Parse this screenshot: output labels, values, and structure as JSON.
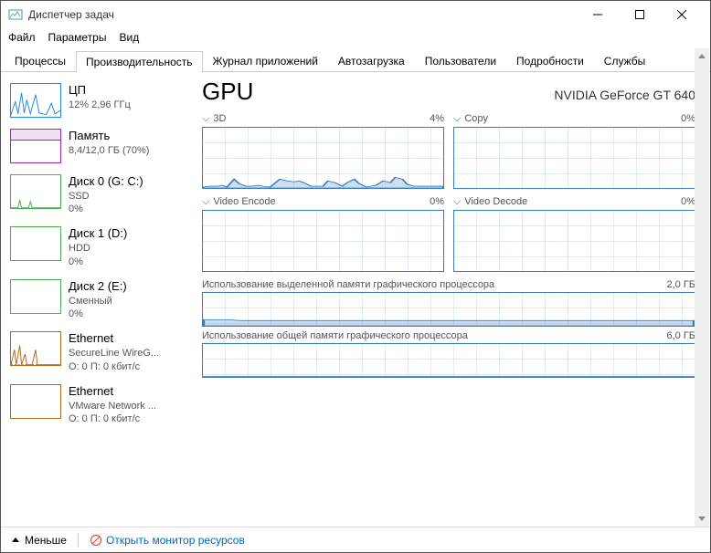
{
  "window": {
    "title": "Диспетчер задач"
  },
  "menubar": {
    "file": "Файл",
    "options": "Параметры",
    "view": "Вид"
  },
  "tabs": {
    "processes": "Процессы",
    "performance": "Производительность",
    "app_history": "Журнал приложений",
    "startup": "Автозагрузка",
    "users": "Пользователи",
    "details": "Подробности",
    "services": "Службы"
  },
  "sidebar": [
    {
      "title": "ЦП",
      "sub1": "12% 2,96 ГГц",
      "color": "#1e88e5"
    },
    {
      "title": "Память",
      "sub1": "8,4/12,0 ГБ (70%)",
      "color": "#9c27b0"
    },
    {
      "title": "Диск 0 (G: C:)",
      "sub1": "SSD",
      "sub2": "0%",
      "color": "#4caf50"
    },
    {
      "title": "Диск 1 (D:)",
      "sub1": "HDD",
      "sub2": "0%",
      "color": "#4caf50"
    },
    {
      "title": "Диск 2 (E:)",
      "sub1": "Сменный",
      "sub2": "0%",
      "color": "#4caf50"
    },
    {
      "title": "Ethernet",
      "sub1": "SecureLine WireG...",
      "sub2": "О: 0 П: 0 кбит/с",
      "color": "#b8641c"
    },
    {
      "title": "Ethernet",
      "sub1": "VMware Network ...",
      "sub2": "О: 0 П: 0 кбит/с",
      "color": "#b8641c"
    }
  ],
  "main": {
    "title": "GPU",
    "device": "NVIDIA GeForce GT 640",
    "g3d": "3D",
    "g3d_pct": "4%",
    "copy": "Copy",
    "copy_pct": "0%",
    "venc": "Video Encode",
    "venc_pct": "0%",
    "vdec": "Video Decode",
    "vdec_pct": "0%",
    "dedmem": "Использование выделенной памяти графического процессора",
    "dedmem_max": "2,0 ГБ",
    "shrmem": "Использование общей памяти графического процессора",
    "shrmem_max": "6,0 ГБ"
  },
  "footer": {
    "less": "Меньше",
    "resmon": "Открыть монитор ресурсов"
  },
  "chart_data": [
    {
      "type": "area",
      "title": "3D",
      "ylim": [
        0,
        100
      ],
      "values": [
        1,
        1,
        2,
        3,
        2,
        1,
        3,
        14,
        8,
        3,
        2,
        4,
        1,
        1,
        2,
        15,
        14,
        10,
        8,
        9,
        7,
        3,
        2,
        1,
        2,
        12,
        8,
        3,
        5,
        14,
        8,
        2,
        4,
        10,
        8,
        18,
        14,
        6,
        3,
        4
      ]
    },
    {
      "type": "area",
      "title": "Copy",
      "ylim": [
        0,
        100
      ],
      "values": [
        0,
        0,
        0,
        0,
        0,
        0,
        0,
        0,
        0,
        0,
        0,
        0,
        0,
        0,
        0,
        0,
        0,
        0,
        0,
        0,
        0,
        0,
        0,
        0,
        0,
        0,
        0,
        0,
        0,
        0,
        0,
        0,
        0,
        0,
        0,
        0,
        0,
        0,
        0,
        0
      ]
    },
    {
      "type": "area",
      "title": "Video Encode",
      "ylim": [
        0,
        100
      ],
      "values": [
        0,
        0,
        0,
        0,
        0,
        0,
        0,
        0,
        0,
        0,
        0,
        0,
        0,
        0,
        0,
        0,
        0,
        0,
        0,
        0,
        0,
        0,
        0,
        0,
        0,
        0,
        0,
        0,
        0,
        0,
        0,
        0,
        0,
        0,
        0,
        0,
        0,
        0,
        0,
        0
      ]
    },
    {
      "type": "area",
      "title": "Video Decode",
      "ylim": [
        0,
        100
      ],
      "values": [
        0,
        0,
        0,
        0,
        0,
        0,
        0,
        0,
        0,
        0,
        0,
        0,
        0,
        0,
        0,
        0,
        0,
        0,
        0,
        0,
        0,
        0,
        0,
        0,
        0,
        0,
        0,
        0,
        0,
        0,
        0,
        0,
        0,
        0,
        0,
        0,
        0,
        0,
        0,
        0
      ]
    },
    {
      "type": "area",
      "title": "Dedicated GPU Memory",
      "ylim": [
        0,
        2.0
      ],
      "unit": "ГБ",
      "values": [
        0.35,
        0.35,
        0.35,
        0.35,
        0.33,
        0.33,
        0.33,
        0.33,
        0.33,
        0.33,
        0.33,
        0.33,
        0.33,
        0.33,
        0.33,
        0.33,
        0.33,
        0.33,
        0.33,
        0.33,
        0.33,
        0.33,
        0.33,
        0.33,
        0.33,
        0.33,
        0.33,
        0.33,
        0.33,
        0.33,
        0.33,
        0.33,
        0.33,
        0.33,
        0.33,
        0.33,
        0.33,
        0.33,
        0.33,
        0.33
      ]
    },
    {
      "type": "area",
      "title": "Shared GPU Memory",
      "ylim": [
        0,
        6.0
      ],
      "unit": "ГБ",
      "values": [
        0.02,
        0.02,
        0.02,
        0.02,
        0.02,
        0.02,
        0.02,
        0.02,
        0.02,
        0.02,
        0.02,
        0.02,
        0.02,
        0.02,
        0.02,
        0.02,
        0.02,
        0.02,
        0.02,
        0.02,
        0.02,
        0.02,
        0.02,
        0.02,
        0.02,
        0.02,
        0.02,
        0.02,
        0.02,
        0.02,
        0.02,
        0.02,
        0.02,
        0.02,
        0.02,
        0.02,
        0.02,
        0.02,
        0.02,
        0.02
      ]
    }
  ]
}
